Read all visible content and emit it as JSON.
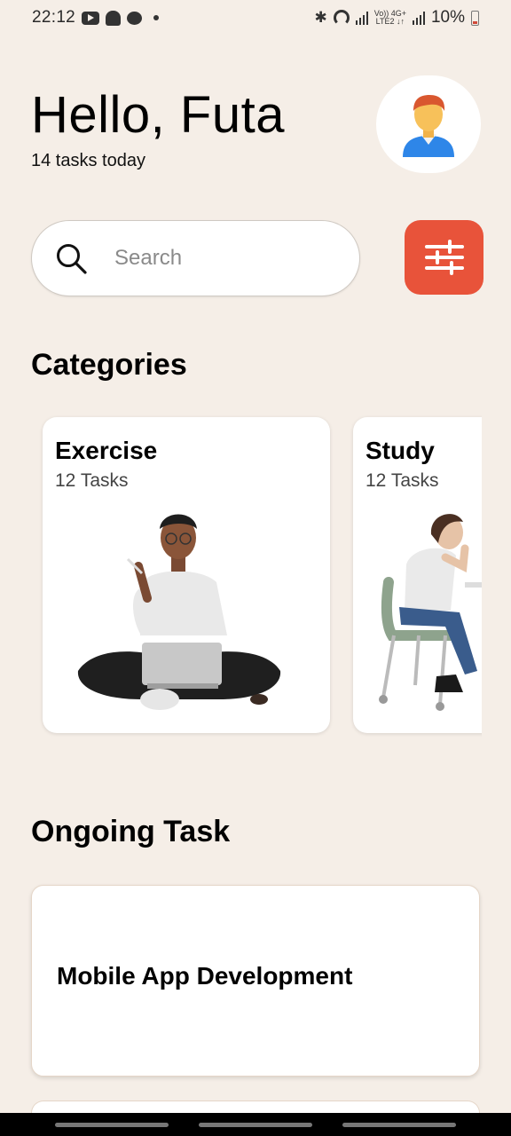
{
  "status_bar": {
    "time": "22:12",
    "battery": "10%",
    "net_top": "Vo)) 4G+",
    "net_bottom": "LTE2 ↓↑"
  },
  "header": {
    "greeting": "Hello, Futa",
    "subtitle": "14 tasks today",
    "avatar_icon": "user-avatar-icon"
  },
  "search": {
    "placeholder": "Search",
    "icon": "search-icon",
    "filter_icon": "sliders-icon",
    "filter_color": "#E8533A"
  },
  "categories": {
    "title": "Categories",
    "items": [
      {
        "name": "Exercise",
        "count": "12 Tasks",
        "illustration": "person-with-laptop"
      },
      {
        "name": "Study",
        "count": "12 Tasks",
        "illustration": "person-at-desk"
      }
    ]
  },
  "ongoing": {
    "title": "Ongoing Task",
    "tasks": [
      {
        "name": "Mobile App Development"
      }
    ]
  },
  "theme": {
    "background": "#F5EEE7",
    "accent": "#E8533A"
  }
}
